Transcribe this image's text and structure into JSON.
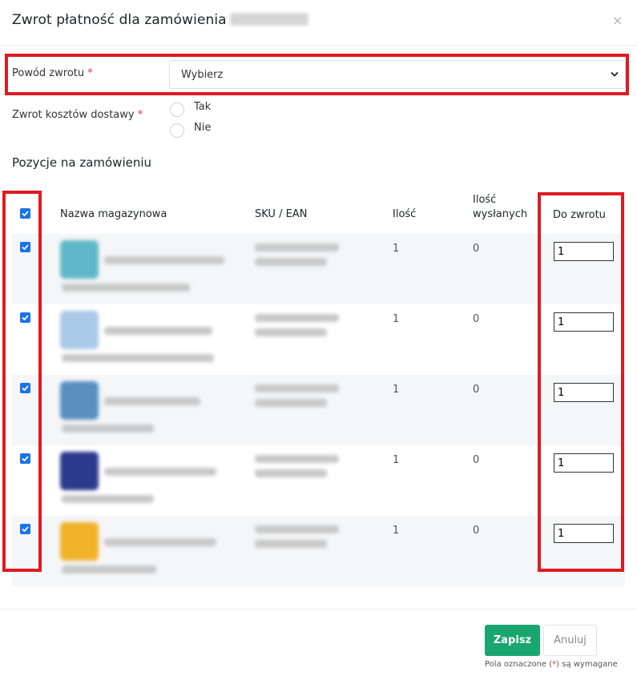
{
  "modal": {
    "title": "Zwrot płatność dla zamówienia",
    "close_glyph": "×"
  },
  "form": {
    "return_reason_label": "Powód zwrotu",
    "required_mark": "*",
    "return_reason_value": "Wybierz",
    "shipping_refund_label": "Zwrot kosztów dostawy",
    "options": [
      "Tak",
      "Nie"
    ]
  },
  "section": {
    "title": "Pozycje na zamówieniu"
  },
  "table": {
    "headers": {
      "name": "Nazwa magazynowa",
      "sku": "SKU / EAN",
      "qty": "Ilość",
      "shipped_line1": "Ilość",
      "shipped_line2": "wysłanych",
      "to_return": "Do zwrotu"
    },
    "rows": [
      {
        "qty": "1",
        "shipped": "0",
        "to_return": "1",
        "checked": true,
        "thumb_color": "#5fb7c9"
      },
      {
        "qty": "1",
        "shipped": "0",
        "to_return": "1",
        "checked": true,
        "thumb_color": "#a9c9e8"
      },
      {
        "qty": "1",
        "shipped": "0",
        "to_return": "1",
        "checked": true,
        "thumb_color": "#5a8fc0"
      },
      {
        "qty": "1",
        "shipped": "0",
        "to_return": "1",
        "checked": true,
        "thumb_color": "#2c3a8c"
      },
      {
        "qty": "1",
        "shipped": "0",
        "to_return": "1",
        "checked": true,
        "thumb_color": "#f0b229"
      }
    ]
  },
  "footer": {
    "save_label": "Zapisz",
    "cancel_label": "Anuluj",
    "note_prefix": "Pola oznaczone (",
    "note_mark": "*",
    "note_suffix": ") są wymagane"
  },
  "colors": {
    "accent_green": "#19a66f",
    "checkbox_blue": "#1a73e8",
    "highlight_red": "#e01a22",
    "required_red": "#e3342f"
  }
}
